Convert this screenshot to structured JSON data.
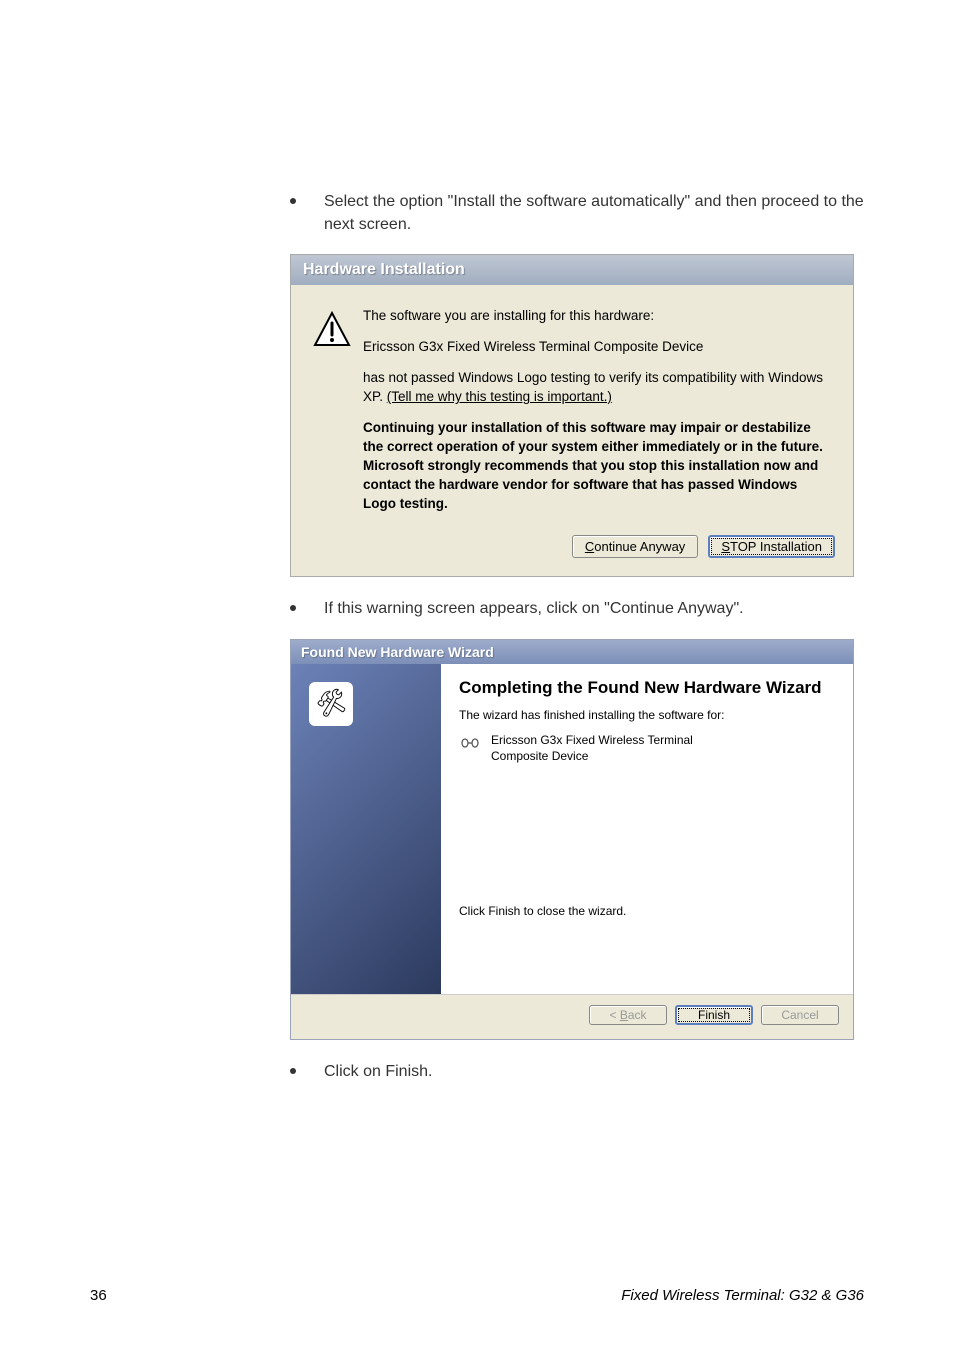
{
  "bullets": {
    "b1": "Select the option \"Install the software automatically\" and then proceed to the next screen.",
    "b2": "If this warning screen appears, click on \"Continue Anyway\".",
    "b3": "Click on Finish."
  },
  "dialog1": {
    "title": "Hardware Installation",
    "line1": "The software you are installing for this hardware:",
    "device": "Ericsson G3x Fixed Wireless Terminal Composite Device",
    "compat_pre": "has not passed Windows Logo testing to verify its compatibility with Windows XP. ",
    "compat_link": "(Tell me why this testing is important.)",
    "warning": "Continuing your installation of this software may impair or destabilize the correct operation of your system either immediately or in the future. Microsoft strongly recommends that you stop this installation now and contact the hardware vendor for software that has passed Windows Logo testing.",
    "btn_continue_pre": "C",
    "btn_continue_post": "ontinue Anyway",
    "btn_stop_pre": "S",
    "btn_stop_post": "TOP Installation"
  },
  "dialog2": {
    "title": "Found New Hardware Wizard",
    "heading": "Completing the Found New Hardware Wizard",
    "sub": "The wizard has finished installing the software for:",
    "device": "Ericsson G3x Fixed Wireless Terminal Composite Device",
    "finish_hint": "Click Finish to close the wizard.",
    "btn_back_pre": "< ",
    "btn_back_u": "B",
    "btn_back_post": "ack",
    "btn_finish": "Finish",
    "btn_cancel": "Cancel"
  },
  "footer": {
    "page": "36",
    "title": "Fixed Wireless Terminal: G32 & G36"
  }
}
